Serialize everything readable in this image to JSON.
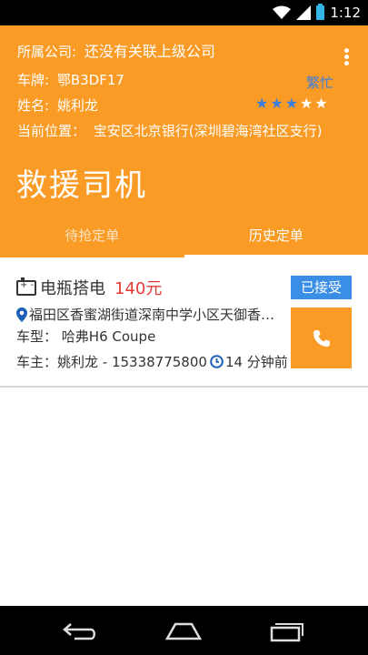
{
  "status_bar": {
    "time": "1:12"
  },
  "header": {
    "company_label": "所属公司:",
    "company_value": "还没有关联上级公司",
    "plate_label": "车牌:",
    "plate_value": "鄂B3DF17",
    "status_badge": "繁忙",
    "name_label": "姓名:",
    "name_value": "姚利龙",
    "rating": 3,
    "rating_max": 5,
    "location_label": "当前位置：",
    "location_value": "宝安区北京银行(深圳碧海湾社区支行)",
    "title": "救援司机"
  },
  "tabs": [
    {
      "label": "待抢定单",
      "active": false
    },
    {
      "label": "历史定单",
      "active": true
    }
  ],
  "order": {
    "service": "电瓶搭电",
    "price": "140元",
    "status": "已接受",
    "address": "福田区香蜜湖街道深南中学小区天御香…",
    "car_label": "车型：",
    "car_value": "哈弗H6 Coupe",
    "owner_label": "车主：",
    "owner_value": "姚利龙 - 15338775800",
    "time_ago": "14 分钟前"
  },
  "colors": {
    "primary": "#f99b25",
    "accent_blue": "#3a8ee6",
    "price_red": "#e53935"
  }
}
